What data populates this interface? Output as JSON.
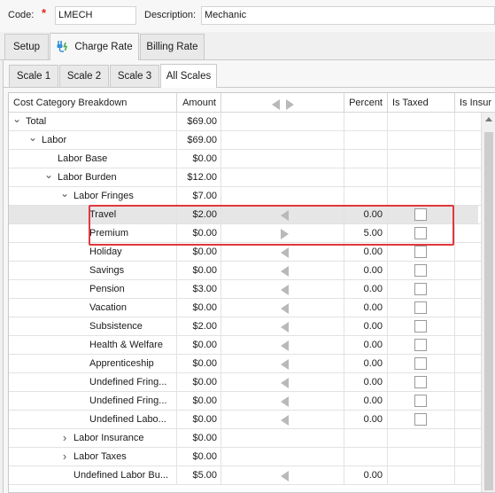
{
  "header": {
    "code_label": "Code:",
    "code_required": "*",
    "code_value": "LMECH",
    "description_label": "Description:",
    "description_value": "Mechanic"
  },
  "main_tabs": [
    {
      "label": "Setup",
      "active": false
    },
    {
      "label": "Charge Rate",
      "active": true,
      "icon": "plug-icon"
    },
    {
      "label": "Billing Rate",
      "active": false
    }
  ],
  "scale_tabs": [
    {
      "label": "Scale 1",
      "active": false
    },
    {
      "label": "Scale 2",
      "active": false
    },
    {
      "label": "Scale 3",
      "active": false
    },
    {
      "label": "All Scales",
      "active": true
    }
  ],
  "grid": {
    "columns": {
      "name": "Cost Category Breakdown",
      "amount": "Amount",
      "percent": "Percent",
      "is_taxed": "Is Taxed",
      "is_insured": "Is Insur"
    },
    "rows": [
      {
        "name": "Total",
        "amount": "$69.00",
        "percent": "",
        "level": 0,
        "expander": "expanded",
        "arrow": "",
        "checkbox": false
      },
      {
        "name": "Labor",
        "amount": "$69.00",
        "percent": "",
        "level": 1,
        "expander": "expanded",
        "arrow": "",
        "checkbox": false
      },
      {
        "name": "Labor Base",
        "amount": "$0.00",
        "percent": "",
        "level": 2,
        "expander": "",
        "arrow": "",
        "checkbox": false
      },
      {
        "name": "Labor Burden",
        "amount": "$12.00",
        "percent": "",
        "level": 2,
        "expander": "expanded",
        "arrow": "",
        "checkbox": false
      },
      {
        "name": "Labor Fringes",
        "amount": "$7.00",
        "percent": "",
        "level": 3,
        "expander": "expanded",
        "arrow": "",
        "checkbox": false
      },
      {
        "name": "Travel",
        "amount": "$2.00",
        "percent": "0.00",
        "level": 4,
        "expander": "",
        "arrow": "left",
        "checkbox": true,
        "selected": true
      },
      {
        "name": "Premium",
        "amount": "$0.00",
        "percent": "5.00",
        "level": 4,
        "expander": "",
        "arrow": "right",
        "checkbox": true
      },
      {
        "name": "Holiday",
        "amount": "$0.00",
        "percent": "0.00",
        "level": 4,
        "expander": "",
        "arrow": "left",
        "checkbox": true
      },
      {
        "name": "Savings",
        "amount": "$0.00",
        "percent": "0.00",
        "level": 4,
        "expander": "",
        "arrow": "left",
        "checkbox": true
      },
      {
        "name": "Pension",
        "amount": "$3.00",
        "percent": "0.00",
        "level": 4,
        "expander": "",
        "arrow": "left",
        "checkbox": true
      },
      {
        "name": "Vacation",
        "amount": "$0.00",
        "percent": "0.00",
        "level": 4,
        "expander": "",
        "arrow": "left",
        "checkbox": true
      },
      {
        "name": "Subsistence",
        "amount": "$2.00",
        "percent": "0.00",
        "level": 4,
        "expander": "",
        "arrow": "left",
        "checkbox": true
      },
      {
        "name": "Health & Welfare",
        "amount": "$0.00",
        "percent": "0.00",
        "level": 4,
        "expander": "",
        "arrow": "left",
        "checkbox": true
      },
      {
        "name": "Apprenticeship",
        "amount": "$0.00",
        "percent": "0.00",
        "level": 4,
        "expander": "",
        "arrow": "left",
        "checkbox": true
      },
      {
        "name": "Undefined Fring...",
        "amount": "$0.00",
        "percent": "0.00",
        "level": 4,
        "expander": "",
        "arrow": "left",
        "checkbox": true
      },
      {
        "name": "Undefined Fring...",
        "amount": "$0.00",
        "percent": "0.00",
        "level": 4,
        "expander": "",
        "arrow": "left",
        "checkbox": true
      },
      {
        "name": "Undefined Labo...",
        "amount": "$0.00",
        "percent": "0.00",
        "level": 4,
        "expander": "",
        "arrow": "left",
        "checkbox": true
      },
      {
        "name": "Labor Insurance",
        "amount": "$0.00",
        "percent": "",
        "level": 3,
        "expander": "collapsed",
        "arrow": "",
        "checkbox": false
      },
      {
        "name": "Labor Taxes",
        "amount": "$0.00",
        "percent": "",
        "level": 3,
        "expander": "collapsed",
        "arrow": "",
        "checkbox": false
      },
      {
        "name": "Undefined Labor Bu...",
        "amount": "$5.00",
        "percent": "0.00",
        "level": 3,
        "expander": "",
        "arrow": "left",
        "checkbox": false
      }
    ]
  },
  "colors": {
    "highlight": "#e2373d",
    "required": "#e0241b",
    "selected_row": "#e6e6e6"
  }
}
